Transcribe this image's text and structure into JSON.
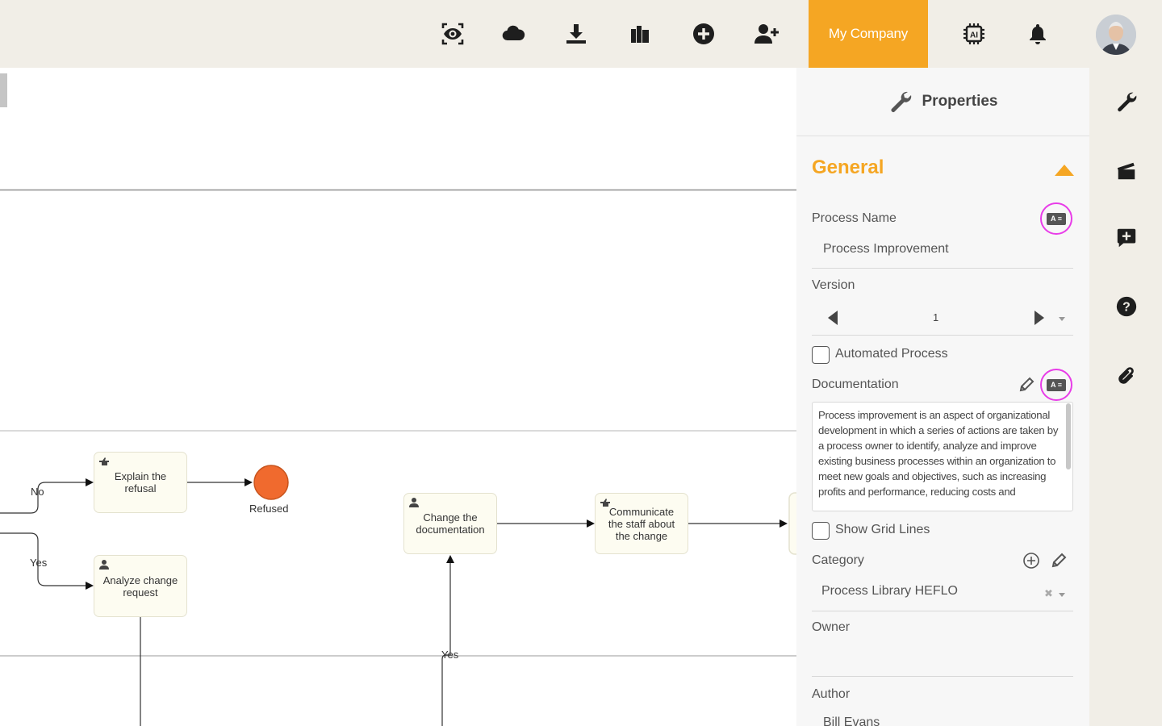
{
  "topbar": {
    "icons": [
      "eye-scan-icon",
      "cloud-icon",
      "download-icon",
      "library-icon",
      "add-circle-icon",
      "add-user-icon"
    ],
    "company": "My Company",
    "right_icons": [
      "ai-chip-icon",
      "bell-icon"
    ]
  },
  "diagram": {
    "tasks": {
      "explain_refusal": "Explain the refusal",
      "analyze_change": "Analyze change request",
      "change_doc": "Change the documentation",
      "communicate": "Communicate the staff about the change"
    },
    "end_event_label": "Refused",
    "flow_labels": {
      "no": "No",
      "yes1": "Yes",
      "yes2": "Yes"
    },
    "colors": {
      "end_event": "#f06a2e",
      "task_fill": "#fdfcf1"
    }
  },
  "properties": {
    "header": "Properties",
    "section": "General",
    "process_name_label": "Process Name",
    "process_name": "Process Improvement",
    "version_label": "Version",
    "version": "1",
    "automated_label": "Automated Process",
    "documentation_label": "Documentation",
    "documentation_text": "Process improvement is an aspect of organizational development in which a series of actions are taken by a process owner to identify, analyze and improve existing business processes within an organization to meet new goals and objectives, such as increasing profits and performance, reducing costs and",
    "grid_label": "Show Grid Lines",
    "category_label": "Category",
    "category_value": "Process Library HEFLO",
    "owner_label": "Owner",
    "author_label": "Author",
    "author_value": "Bill Evans",
    "badge_text": "A ≡"
  },
  "rail": {
    "icons": [
      "wrench-icon",
      "clapperboard-icon",
      "comment-add-icon",
      "help-icon",
      "paperclip-icon"
    ]
  },
  "colors": {
    "accent": "#f5a623",
    "highlight": "#e83ce8",
    "topbar_bg": "#f1eee7"
  }
}
